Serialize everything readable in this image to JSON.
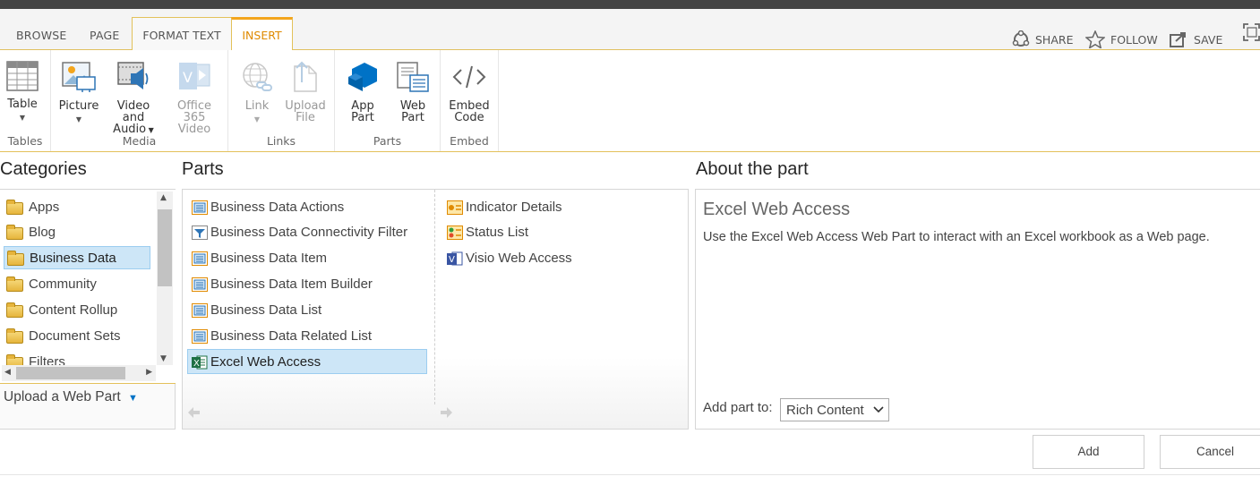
{
  "tabs": [
    "BROWSE",
    "PAGE",
    "FORMAT TEXT",
    "INSERT"
  ],
  "actions": {
    "share": "SHARE",
    "follow": "FOLLOW",
    "save": "SAVE"
  },
  "ribbon": {
    "tables": {
      "label": "Tables",
      "table": "Table"
    },
    "media": {
      "label": "Media",
      "picture": "Picture",
      "video_line1": "Video and",
      "video_line2": "Audio",
      "office_line1": "Office 365",
      "office_line2": "Video"
    },
    "links": {
      "label": "Links",
      "link": "Link",
      "upload_line1": "Upload",
      "upload_line2": "File"
    },
    "parts": {
      "label": "Parts",
      "app_line1": "App",
      "app_line2": "Part",
      "web_line1": "Web",
      "web_line2": "Part"
    },
    "embed": {
      "label": "Embed",
      "embed_line1": "Embed",
      "embed_line2": "Code"
    }
  },
  "categories": {
    "title": "Categories",
    "items": [
      "Apps",
      "Blog",
      "Business Data",
      "Community",
      "Content Rollup",
      "Document Sets",
      "Filters"
    ],
    "selected": "Business Data",
    "upload": "Upload a Web Part"
  },
  "parts": {
    "title": "Parts",
    "col1": [
      "Business Data Actions",
      "Business Data Connectivity Filter",
      "Business Data Item",
      "Business Data Item Builder",
      "Business Data List",
      "Business Data Related List",
      "Excel Web Access"
    ],
    "col2": [
      "Indicator Details",
      "Status List",
      "Visio Web Access"
    ],
    "selected": "Excel Web Access"
  },
  "about": {
    "title": "About the part",
    "name": "Excel Web Access",
    "description": "Use the Excel Web Access Web Part to interact with an Excel workbook as a Web page.",
    "add_part_to_label": "Add part to:",
    "zone": "Rich Content"
  },
  "buttons": {
    "add": "Add",
    "cancel": "Cancel"
  },
  "colors": {
    "accent": "#f3a51d",
    "selected_bg": "#cde6f7",
    "brand_blue": "#0072c6"
  }
}
